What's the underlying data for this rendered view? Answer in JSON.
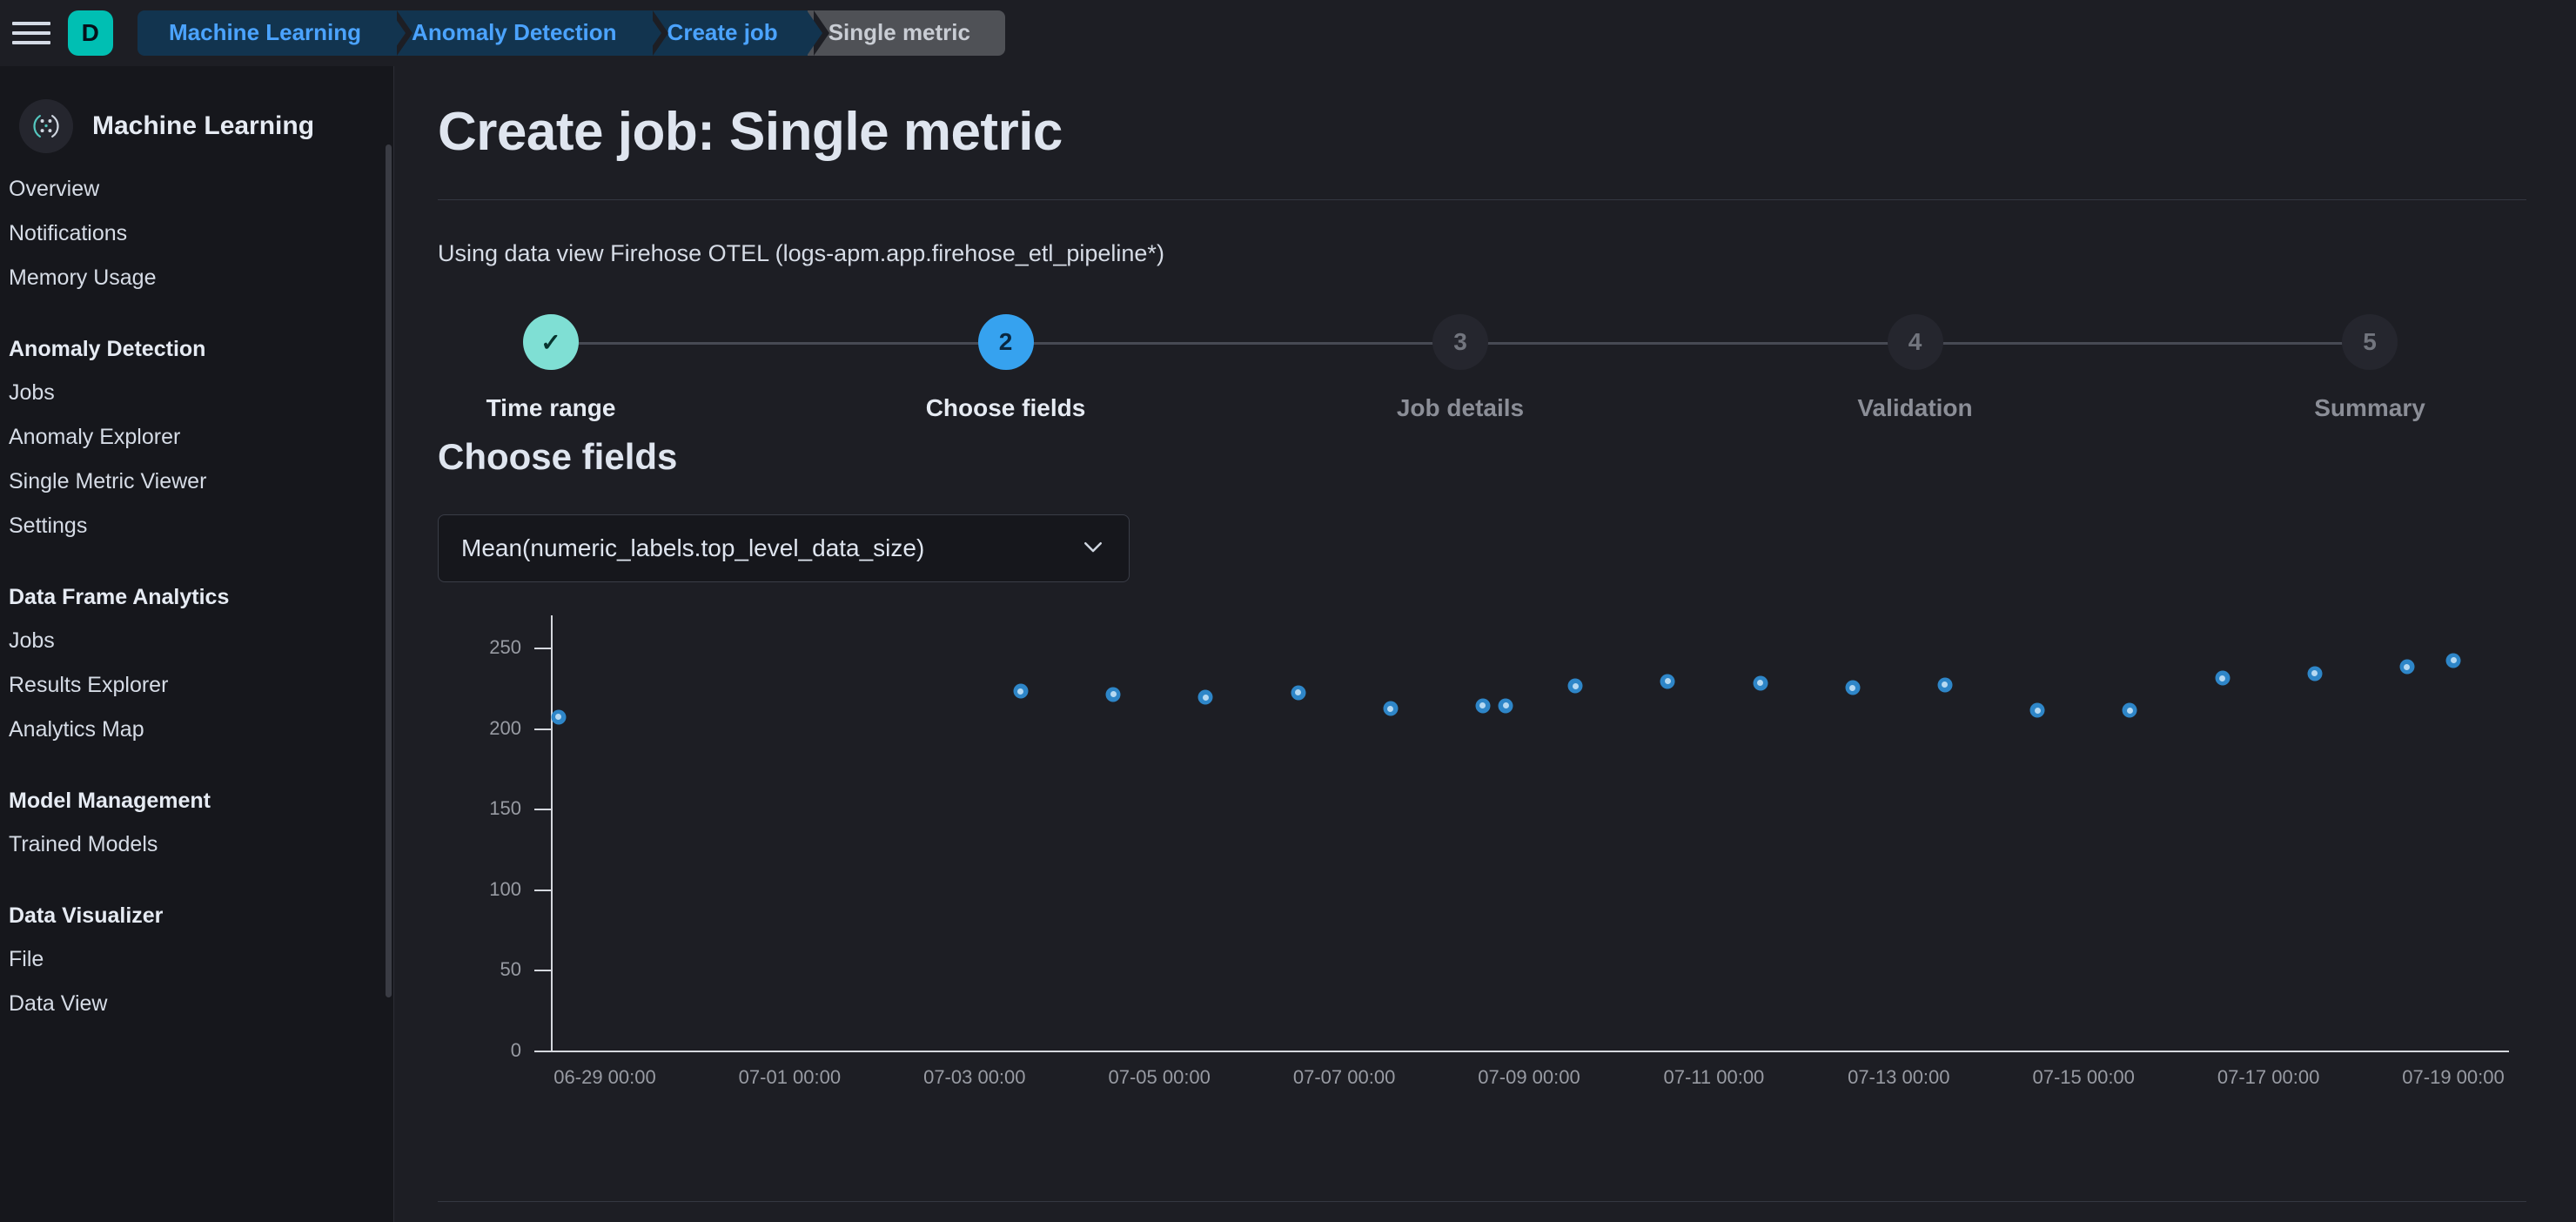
{
  "topbar": {
    "menu_icon": "hamburger-icon",
    "avatar_initial": "D",
    "avatar_color": "#00bfb3",
    "breadcrumbs": [
      {
        "label": "Machine Learning",
        "active": false
      },
      {
        "label": "Anomaly Detection",
        "active": false
      },
      {
        "label": "Create job",
        "active": false
      },
      {
        "label": "Single metric",
        "active": true
      }
    ]
  },
  "sidebar": {
    "logo_icon": "machine-learning-icon",
    "title": "Machine Learning",
    "groups": [
      {
        "heading": "",
        "items": [
          {
            "label": "Overview"
          },
          {
            "label": "Notifications"
          },
          {
            "label": "Memory Usage"
          }
        ]
      },
      {
        "heading": "Anomaly Detection",
        "items": [
          {
            "label": "Jobs"
          },
          {
            "label": "Anomaly Explorer"
          },
          {
            "label": "Single Metric Viewer"
          },
          {
            "label": "Settings"
          }
        ]
      },
      {
        "heading": "Data Frame Analytics",
        "items": [
          {
            "label": "Jobs"
          },
          {
            "label": "Results Explorer"
          },
          {
            "label": "Analytics Map"
          }
        ]
      },
      {
        "heading": "Model Management",
        "items": [
          {
            "label": "Trained Models"
          }
        ]
      },
      {
        "heading": "Data Visualizer",
        "items": [
          {
            "label": "File"
          },
          {
            "label": "Data View"
          }
        ]
      }
    ]
  },
  "main": {
    "page_title": "Create job: Single metric",
    "dataview_note": "Using data view Firehose OTEL (logs-apm.app.firehose_etl_pipeline*)",
    "steps": [
      {
        "number": "1",
        "marker": "✓",
        "label": "Time range",
        "state": "done"
      },
      {
        "number": "2",
        "marker": "2",
        "label": "Choose fields",
        "state": "current"
      },
      {
        "number": "3",
        "marker": "3",
        "label": "Job details",
        "state": "todo"
      },
      {
        "number": "4",
        "marker": "4",
        "label": "Validation",
        "state": "todo"
      },
      {
        "number": "5",
        "marker": "5",
        "label": "Summary",
        "state": "todo"
      }
    ],
    "section_title": "Choose fields",
    "field_select": {
      "value": "Mean(numeric_labels.top_level_data_size)",
      "chevron_icon": "chevron-down-icon"
    }
  },
  "chart_data": {
    "type": "scatter",
    "title": "",
    "xlabel": "",
    "ylabel": "",
    "ylim": [
      0,
      270
    ],
    "yticks": [
      0,
      50,
      100,
      150,
      200,
      250
    ],
    "xticks": [
      "06-29 00:00",
      "07-01 00:00",
      "07-03 00:00",
      "07-05 00:00",
      "07-07 00:00",
      "07-09 00:00",
      "07-11 00:00",
      "07-13 00:00",
      "07-15 00:00",
      "07-17 00:00",
      "07-19 00:00"
    ],
    "grid": false,
    "legend": "none",
    "point_color": "#2e86c8",
    "series": [
      {
        "name": "Mean(numeric_labels.top_level_data_size)",
        "points": [
          {
            "x": "06-28 12:00",
            "y": 207
          },
          {
            "x": "07-03 12:00",
            "y": 223
          },
          {
            "x": "07-04 12:00",
            "y": 221
          },
          {
            "x": "07-05 12:00",
            "y": 219
          },
          {
            "x": "07-06 12:00",
            "y": 222
          },
          {
            "x": "07-07 12:00",
            "y": 212
          },
          {
            "x": "07-08 12:00",
            "y": 214
          },
          {
            "x": "07-08 18:00",
            "y": 214
          },
          {
            "x": "07-09 12:00",
            "y": 226
          },
          {
            "x": "07-10 12:00",
            "y": 229
          },
          {
            "x": "07-11 12:00",
            "y": 228
          },
          {
            "x": "07-12 12:00",
            "y": 225
          },
          {
            "x": "07-13 12:00",
            "y": 227
          },
          {
            "x": "07-14 12:00",
            "y": 211
          },
          {
            "x": "07-15 12:00",
            "y": 211
          },
          {
            "x": "07-16 12:00",
            "y": 231
          },
          {
            "x": "07-17 12:00",
            "y": 234
          },
          {
            "x": "07-18 12:00",
            "y": 238
          },
          {
            "x": "07-19 00:00",
            "y": 242
          }
        ]
      }
    ]
  }
}
